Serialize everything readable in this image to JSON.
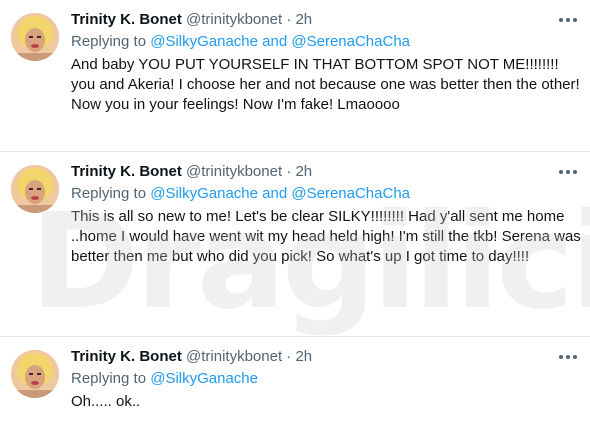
{
  "watermark": "Dragilicious",
  "tweets": [
    {
      "name": "Trinity K. Bonet",
      "handle": "@trinitykbonet",
      "separator": "·",
      "time": "2h",
      "replying_prefix": "Replying to",
      "mention1": "@SilkyGanache",
      "and_word": "and",
      "mention2": "@SerenaChaCha",
      "text": "And baby YOU PUT YOURSELF IN THAT BOTTOM SPOT NOT ME!!!!!!!! you and Akeria! I choose her and not because one was better then the other! Now you in your feelings! Now I'm fake! Lmaoooo"
    },
    {
      "name": "Trinity K. Bonet",
      "handle": "@trinitykbonet",
      "separator": "·",
      "time": "2h",
      "replying_prefix": "Replying to",
      "mention1": "@SilkyGanache",
      "and_word": "and",
      "mention2": "@SerenaChaCha",
      "text": "This is all so new to me! Let's be clear SILKY!!!!!!!! Had y'all sent me home ..home I would have went wit my head held high! I'm still the tkb! Serena was better then me but who did you pick! So what's up I got time to day!!!!"
    },
    {
      "name": "Trinity K. Bonet",
      "handle": "@trinitykbonet",
      "separator": "·",
      "time": "2h",
      "replying_prefix": "Replying to",
      "mention1": "@SilkyGanache",
      "text": "Oh..... ok.."
    }
  ],
  "icons": {
    "avatar": "profile-photo",
    "more": "more-options-icon"
  },
  "colors": {
    "link": "#1d9bf0",
    "secondary": "#536471",
    "divider": "#e6e9ec"
  }
}
